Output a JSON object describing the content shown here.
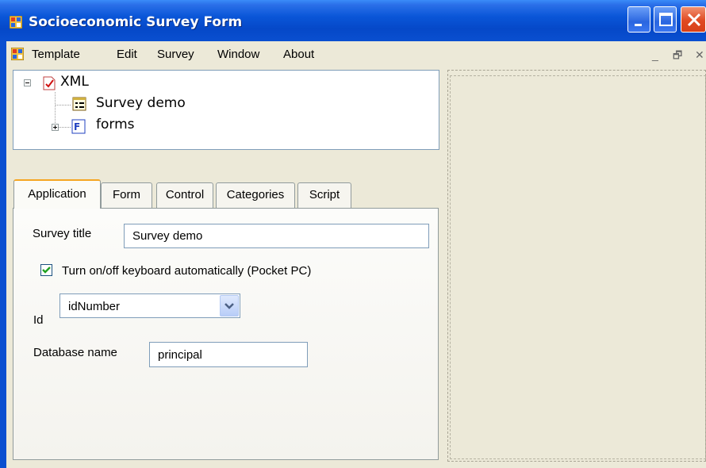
{
  "window": {
    "title": "Socioeconomic Survey Form",
    "icon": "app-form-icon",
    "controls": [
      "minimize-icon",
      "maximize-icon",
      "close-icon"
    ]
  },
  "menu": {
    "items": [
      {
        "label": "Template"
      },
      {
        "label": "Edit"
      },
      {
        "label": "Survey"
      },
      {
        "label": "Window"
      },
      {
        "label": "About"
      }
    ],
    "mdi_restore": "_",
    "mdi_max": "🗗",
    "mdi_close": "✕"
  },
  "tree": {
    "root": {
      "label": "XML",
      "icon": "xml-document-icon",
      "expanded": true
    },
    "children": [
      {
        "label": "Survey demo",
        "icon": "survey-form-icon"
      },
      {
        "label": "forms",
        "icon": "forms-icon",
        "expanded": false
      }
    ]
  },
  "tabs": [
    {
      "label": "Application",
      "active": true
    },
    {
      "label": "Form"
    },
    {
      "label": "Control"
    },
    {
      "label": "Categories"
    },
    {
      "label": "Script"
    }
  ],
  "application": {
    "survey_title_label": "Survey title",
    "survey_title_value": "Survey demo",
    "keyboard_label": "Turn on/off keyboard automatically (Pocket PC)",
    "keyboard_checked": true,
    "id_label": "Id",
    "id_value": "idNumber",
    "database_label": "Database name",
    "database_value": "principal"
  },
  "colors": {
    "titlebar": "#0a4fd0",
    "close_button": "#e04a22",
    "active_tab_accent": "#f5a623",
    "checkmark": "#21a121"
  }
}
